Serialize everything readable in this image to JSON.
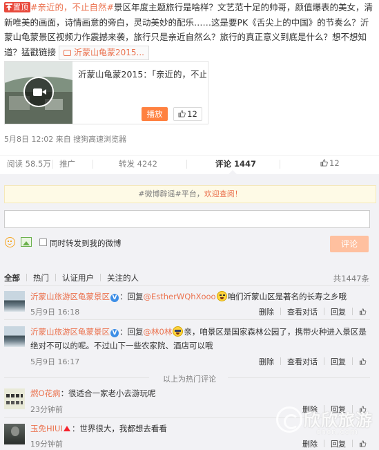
{
  "post": {
    "top_badge": "置顶",
    "topic": "#亲近的，不止自然#",
    "body_1": "景区年度主题旅行是啥样？文艺范十足的帅哥，颜值爆表的美女，清新唯美的画面，诗情画意的旁白，灵动美妙的配乐……这是要PK《舌尖上的中国》的节奏么？沂蒙山龟蒙景区视频力作震撼来袭，旅行只是亲近自然么？旅行的真正意义到底是什么？想不想知道？猛戳链接",
    "link_label": "沂蒙山龟蒙2015...",
    "meta": "5月8日 12:02 来自 搜狗高速浏览器"
  },
  "video_card": {
    "title": "沂蒙山龟蒙2015：「亲近的，不止...",
    "play_label": "播放",
    "like_count": "12"
  },
  "actions": {
    "read": "阅读 58.5万",
    "promote": "推广",
    "forward": "转发 4242",
    "comment": "评论 1447",
    "like": "12"
  },
  "comment_box": {
    "notice_prefix": "#微博辟谣#平台，",
    "notice_highlight": "欢迎查阅！",
    "repost_label": "同时转发到我的微博",
    "submit_label": "评论"
  },
  "filters": {
    "items": [
      "全部",
      "热门",
      "认证用户",
      "关注的人"
    ],
    "total": "共1447条"
  },
  "comments": [
    {
      "user": "沂蒙山旅游区龟蒙景区",
      "reply_prefix": "：回复",
      "mention": "@EstherWQhXooo",
      "text_after": "咱们沂蒙山区是著名的长寿之乡哦",
      "time": "5月9日 16:18",
      "ops": [
        "删除",
        "查看对话",
        "回复"
      ],
      "likes": ""
    },
    {
      "user": "沂蒙山旅游区龟蒙景区",
      "reply_prefix": "：回复",
      "mention": "@林0林",
      "text_after": "亲，咱景区是国家森林公园了，携带火种进入景区是绝对不可以的呢。不过山下一些农家院、酒店可以哦",
      "time": "5月9日 16:17",
      "ops": [
        "删除",
        "查看对话",
        "回复"
      ],
      "likes": ""
    },
    {
      "user": "燃O花病",
      "text": "：很适合一家老小去游玩呢",
      "time": "23分钟前",
      "ops": [
        "删除",
        "回复"
      ]
    },
    {
      "user": "玉免HIUI",
      "text": "：世界很大，我都想去看看",
      "time": "19分钟前",
      "ops": [
        "删除",
        "回复"
      ]
    }
  ],
  "hot_end": "以上为热门评论",
  "watermark": {
    "text": "欣欣旅游",
    "url": "cncn.com"
  },
  "colors": {
    "accent": "#eb7350",
    "link_blue": "#3b73b9",
    "submit_disabled": "#ffc09f",
    "play_orange": "#ff8140",
    "panel_bg": "#f2f2f5"
  }
}
